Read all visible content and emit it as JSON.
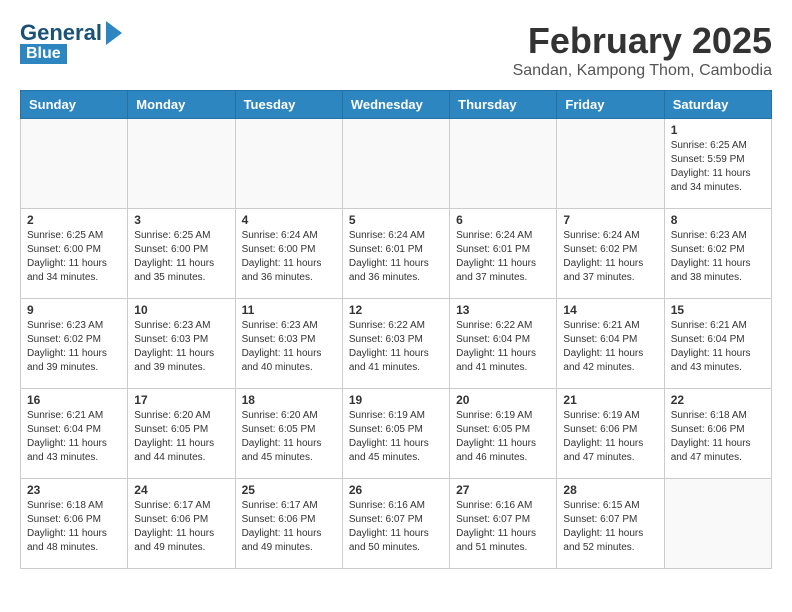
{
  "header": {
    "logo_general": "General",
    "logo_blue": "Blue",
    "month_title": "February 2025",
    "location": "Sandan, Kampong Thom, Cambodia"
  },
  "days_of_week": [
    "Sunday",
    "Monday",
    "Tuesday",
    "Wednesday",
    "Thursday",
    "Friday",
    "Saturday"
  ],
  "weeks": [
    [
      {
        "day": "",
        "info": ""
      },
      {
        "day": "",
        "info": ""
      },
      {
        "day": "",
        "info": ""
      },
      {
        "day": "",
        "info": ""
      },
      {
        "day": "",
        "info": ""
      },
      {
        "day": "",
        "info": ""
      },
      {
        "day": "1",
        "info": "Sunrise: 6:25 AM\nSunset: 5:59 PM\nDaylight: 11 hours\nand 34 minutes."
      }
    ],
    [
      {
        "day": "2",
        "info": "Sunrise: 6:25 AM\nSunset: 6:00 PM\nDaylight: 11 hours\nand 34 minutes."
      },
      {
        "day": "3",
        "info": "Sunrise: 6:25 AM\nSunset: 6:00 PM\nDaylight: 11 hours\nand 35 minutes."
      },
      {
        "day": "4",
        "info": "Sunrise: 6:24 AM\nSunset: 6:00 PM\nDaylight: 11 hours\nand 36 minutes."
      },
      {
        "day": "5",
        "info": "Sunrise: 6:24 AM\nSunset: 6:01 PM\nDaylight: 11 hours\nand 36 minutes."
      },
      {
        "day": "6",
        "info": "Sunrise: 6:24 AM\nSunset: 6:01 PM\nDaylight: 11 hours\nand 37 minutes."
      },
      {
        "day": "7",
        "info": "Sunrise: 6:24 AM\nSunset: 6:02 PM\nDaylight: 11 hours\nand 37 minutes."
      },
      {
        "day": "8",
        "info": "Sunrise: 6:23 AM\nSunset: 6:02 PM\nDaylight: 11 hours\nand 38 minutes."
      }
    ],
    [
      {
        "day": "9",
        "info": "Sunrise: 6:23 AM\nSunset: 6:02 PM\nDaylight: 11 hours\nand 39 minutes."
      },
      {
        "day": "10",
        "info": "Sunrise: 6:23 AM\nSunset: 6:03 PM\nDaylight: 11 hours\nand 39 minutes."
      },
      {
        "day": "11",
        "info": "Sunrise: 6:23 AM\nSunset: 6:03 PM\nDaylight: 11 hours\nand 40 minutes."
      },
      {
        "day": "12",
        "info": "Sunrise: 6:22 AM\nSunset: 6:03 PM\nDaylight: 11 hours\nand 41 minutes."
      },
      {
        "day": "13",
        "info": "Sunrise: 6:22 AM\nSunset: 6:04 PM\nDaylight: 11 hours\nand 41 minutes."
      },
      {
        "day": "14",
        "info": "Sunrise: 6:21 AM\nSunset: 6:04 PM\nDaylight: 11 hours\nand 42 minutes."
      },
      {
        "day": "15",
        "info": "Sunrise: 6:21 AM\nSunset: 6:04 PM\nDaylight: 11 hours\nand 43 minutes."
      }
    ],
    [
      {
        "day": "16",
        "info": "Sunrise: 6:21 AM\nSunset: 6:04 PM\nDaylight: 11 hours\nand 43 minutes."
      },
      {
        "day": "17",
        "info": "Sunrise: 6:20 AM\nSunset: 6:05 PM\nDaylight: 11 hours\nand 44 minutes."
      },
      {
        "day": "18",
        "info": "Sunrise: 6:20 AM\nSunset: 6:05 PM\nDaylight: 11 hours\nand 45 minutes."
      },
      {
        "day": "19",
        "info": "Sunrise: 6:19 AM\nSunset: 6:05 PM\nDaylight: 11 hours\nand 45 minutes."
      },
      {
        "day": "20",
        "info": "Sunrise: 6:19 AM\nSunset: 6:05 PM\nDaylight: 11 hours\nand 46 minutes."
      },
      {
        "day": "21",
        "info": "Sunrise: 6:19 AM\nSunset: 6:06 PM\nDaylight: 11 hours\nand 47 minutes."
      },
      {
        "day": "22",
        "info": "Sunrise: 6:18 AM\nSunset: 6:06 PM\nDaylight: 11 hours\nand 47 minutes."
      }
    ],
    [
      {
        "day": "23",
        "info": "Sunrise: 6:18 AM\nSunset: 6:06 PM\nDaylight: 11 hours\nand 48 minutes."
      },
      {
        "day": "24",
        "info": "Sunrise: 6:17 AM\nSunset: 6:06 PM\nDaylight: 11 hours\nand 49 minutes."
      },
      {
        "day": "25",
        "info": "Sunrise: 6:17 AM\nSunset: 6:06 PM\nDaylight: 11 hours\nand 49 minutes."
      },
      {
        "day": "26",
        "info": "Sunrise: 6:16 AM\nSunset: 6:07 PM\nDaylight: 11 hours\nand 50 minutes."
      },
      {
        "day": "27",
        "info": "Sunrise: 6:16 AM\nSunset: 6:07 PM\nDaylight: 11 hours\nand 51 minutes."
      },
      {
        "day": "28",
        "info": "Sunrise: 6:15 AM\nSunset: 6:07 PM\nDaylight: 11 hours\nand 52 minutes."
      },
      {
        "day": "",
        "info": ""
      }
    ]
  ]
}
